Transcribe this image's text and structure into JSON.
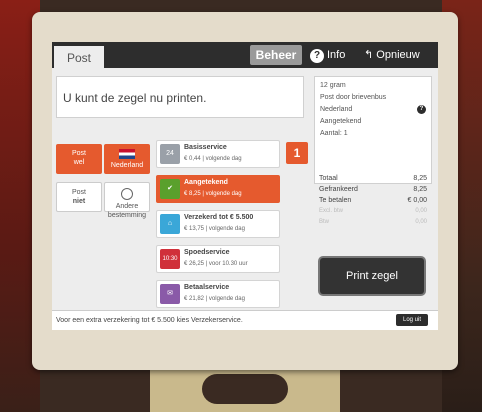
{
  "topbar": {
    "tab_post": "Post",
    "tab_beheer": "Beheer",
    "info_label": "Info",
    "opnieuw_label": "Opnieuw"
  },
  "message": "U kunt de zegel nu printen.",
  "options": {
    "post_wel": [
      "Post",
      "wel"
    ],
    "country": "Nederland",
    "post_niet": [
      "Post",
      "niet"
    ],
    "andere": [
      "Andere",
      "bestemming"
    ]
  },
  "services": [
    {
      "name": "Basisservice",
      "price": "€ 0,44 | volgende dag",
      "icon_text": "24",
      "icon": "clock-icon",
      "color": "#9aa0a8"
    },
    {
      "name": "Aangetekend",
      "price": "€ 8,25 | volgende dag",
      "icon_text": "✔",
      "icon": "check-icon",
      "color": "#5aa02c"
    },
    {
      "name": "Verzekerd tot € 5.500",
      "price": "€ 13,75 | volgende dag",
      "icon_text": "⌂",
      "icon": "shield-icon",
      "color": "#3aa7d8"
    },
    {
      "name": "Spoedservice",
      "price": "€ 26,25 | voor 10.30 uur",
      "icon_text": "10:30",
      "icon": "envelope-icon",
      "color": "#d0303a"
    },
    {
      "name": "Betaalservice",
      "price": "€ 21,82 | volgende dag",
      "icon_text": "✉",
      "icon": "payment-icon",
      "color": "#8a5aa8"
    }
  ],
  "selected_count": "1",
  "summary": {
    "weight": "12 gram",
    "delivery": "Post door brievenbus",
    "destination": "Nederland",
    "service": "Aangetekend",
    "quantity": "Aantal: 1"
  },
  "totals": {
    "totaal_label": "Totaal",
    "totaal_value": "8,25",
    "gefrankeerd_label": "Gefrankeerd",
    "gefrankeerd_value": "8,25",
    "te_betalen_label": "Te betalen",
    "te_betalen_value": "€ 0,00",
    "excl_label": "Excl. btw",
    "excl_value": "0,00",
    "btw_label": "Btw",
    "btw_value": "0,00"
  },
  "print_label": "Print zegel",
  "footer_text": "Voor een extra verzekering tot € 5.500 kies Verzekerservice.",
  "logout_label": "Log uit",
  "colors": {
    "accent": "#e55a2e",
    "topbar": "#2d2d2d",
    "bezel": "#e4dccb"
  }
}
